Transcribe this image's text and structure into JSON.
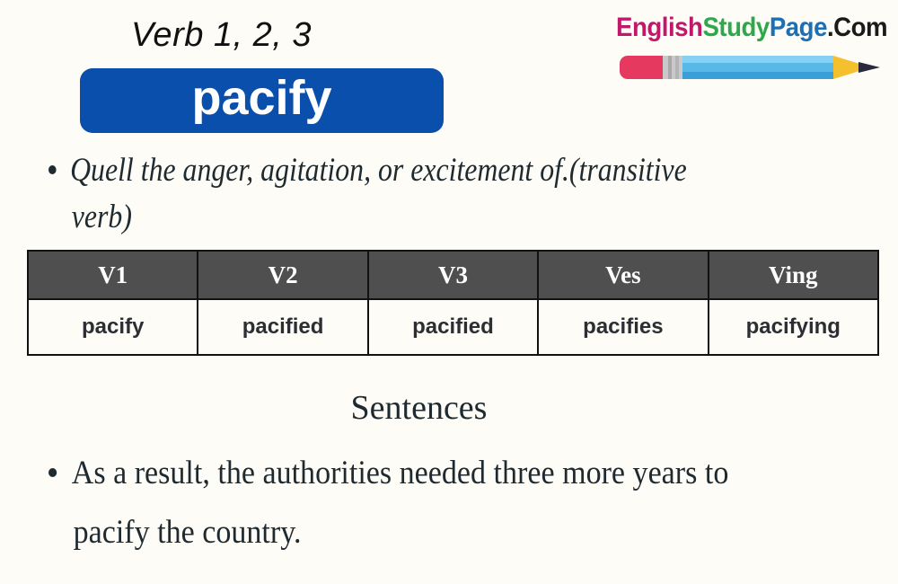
{
  "header": {
    "subtitle": "Verb 1, 2, 3",
    "word": "pacify"
  },
  "logo": {
    "part1": "English",
    "part2": "Study",
    "part3": "Page",
    "part4": ".Com",
    "icon": "pencil-icon",
    "colors": {
      "english": "#c2186b",
      "study": "#2ea84a",
      "page": "#1c6fb5",
      "com": "#1a1a1a"
    }
  },
  "definition": {
    "line1": "Quell the anger, agitation, or excitement of.(transitive",
    "line2": "verb)"
  },
  "table": {
    "headers": [
      "V1",
      "V2",
      "V3",
      "Ves",
      "Ving"
    ],
    "values": [
      "pacify",
      "pacified",
      "pacified",
      "pacifies",
      "pacifying"
    ]
  },
  "sentences": {
    "heading": "Sentences",
    "items": [
      {
        "line1": "As a result, the authorities needed three more years to",
        "line2": "pacify the country."
      }
    ]
  },
  "colors": {
    "background": "#fdfcf6",
    "pill": "#0b4fad",
    "table_header": "#4f4f4f"
  }
}
